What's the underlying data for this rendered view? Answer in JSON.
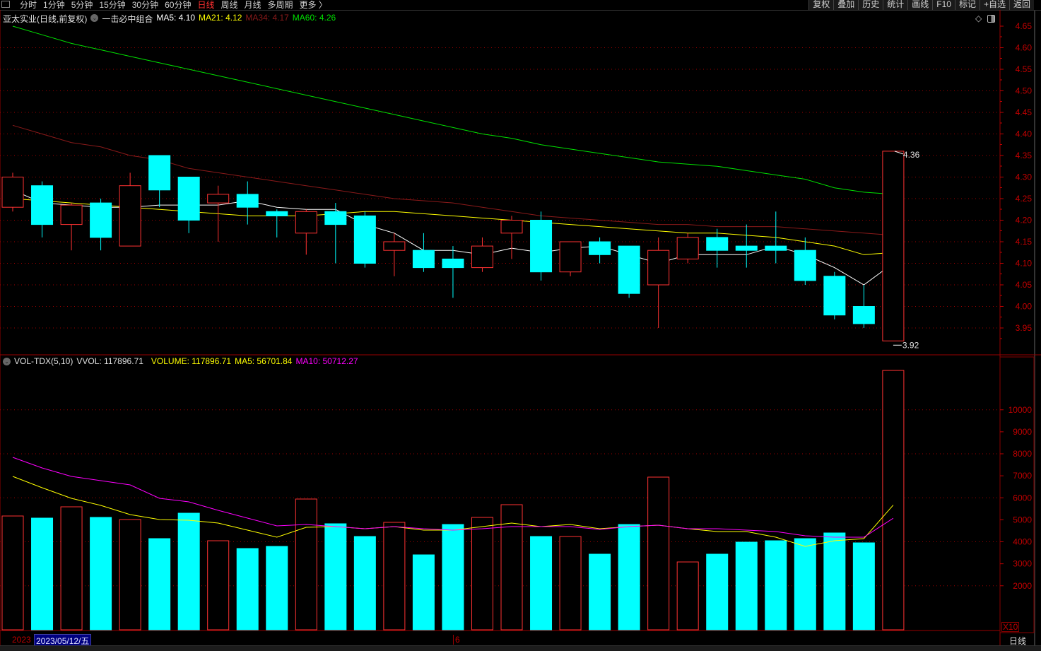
{
  "toolbar": {
    "periods": [
      "分时",
      "1分钟",
      "5分钟",
      "15分钟",
      "30分钟",
      "60分钟",
      "日线",
      "周线",
      "月线",
      "多周期",
      "更多 〉"
    ],
    "active_period": "日线",
    "buttons": [
      "复权",
      "叠加",
      "历史",
      "统计",
      "画线",
      "F10",
      "标记",
      "+自选",
      "返回"
    ]
  },
  "price_legend": {
    "title": "亚太实业(日线,前复权)",
    "indicator": "一击必中组合",
    "ma5": "MA5: 4.10",
    "ma21": "MA21: 4.12",
    "ma34": "MA34: 4.17",
    "ma60": "MA60: 4.26"
  },
  "volume_legend": {
    "name": "VOL-TDX(5,10)",
    "vvol": "VVOL: 117896.71",
    "volume": "VOLUME: 117896.71",
    "ma5": "MA5: 56701.84",
    "ma10": "MA10: 50712.27"
  },
  "colors": {
    "up": "#ff3232",
    "down": "#00ffff",
    "ma5": "#ffffff",
    "ma21": "#ffff00",
    "ma34": "#8b1a1a",
    "ma60": "#00e000",
    "vol_ma5": "#ffff00",
    "vol_ma10": "#ff00ff",
    "axis": "#c00000"
  },
  "icons": {
    "legend_toggle": "chevron-down-circle-icon",
    "diamond": "diamond-icon",
    "panel": "panel-toggle-icon"
  },
  "date_axis": {
    "left_label": "2023",
    "cursor_date": "2023/05/12/五",
    "month_label": "6"
  },
  "period_label": "日线",
  "volume_unit": "X10",
  "chart_data": [
    {
      "type": "candlestick",
      "price_axis": {
        "ticks": [
          4.65,
          4.6,
          4.55,
          4.5,
          4.45,
          4.4,
          4.35,
          4.3,
          4.25,
          4.2,
          4.15,
          4.1,
          4.05,
          4.0,
          3.95
        ],
        "range": [
          3.92,
          4.65
        ]
      },
      "high_label": "4.36",
      "low_label": "3.92",
      "ohlc": [
        [
          4.23,
          4.31,
          4.22,
          4.3
        ],
        [
          4.28,
          4.29,
          4.16,
          4.19
        ],
        [
          4.19,
          4.24,
          4.13,
          4.235
        ],
        [
          4.24,
          4.25,
          4.13,
          4.16
        ],
        [
          4.14,
          4.31,
          4.14,
          4.28
        ],
        [
          4.35,
          4.35,
          4.23,
          4.27
        ],
        [
          4.3,
          4.3,
          4.17,
          4.2
        ],
        [
          4.24,
          4.28,
          4.15,
          4.26
        ],
        [
          4.26,
          4.29,
          4.19,
          4.23
        ],
        [
          4.22,
          4.225,
          4.16,
          4.21
        ],
        [
          4.17,
          4.225,
          4.12,
          4.22
        ],
        [
          4.22,
          4.24,
          4.1,
          4.19
        ],
        [
          4.21,
          4.22,
          4.09,
          4.1
        ],
        [
          4.13,
          4.17,
          4.07,
          4.15
        ],
        [
          4.13,
          4.17,
          4.08,
          4.09
        ],
        [
          4.11,
          4.14,
          4.02,
          4.09
        ],
        [
          4.09,
          4.16,
          4.08,
          4.14
        ],
        [
          4.17,
          4.21,
          4.11,
          4.2
        ],
        [
          4.2,
          4.22,
          4.06,
          4.08
        ],
        [
          4.08,
          4.15,
          4.07,
          4.15
        ],
        [
          4.15,
          4.16,
          4.1,
          4.12
        ],
        [
          4.14,
          4.14,
          4.02,
          4.03
        ],
        [
          4.05,
          4.16,
          3.95,
          4.13
        ],
        [
          4.11,
          4.17,
          4.1,
          4.16
        ],
        [
          4.16,
          4.18,
          4.09,
          4.13
        ],
        [
          4.14,
          4.19,
          4.09,
          4.13
        ],
        [
          4.14,
          4.22,
          4.1,
          4.13
        ],
        [
          4.13,
          4.16,
          4.05,
          4.06
        ],
        [
          4.07,
          4.08,
          3.97,
          3.98
        ],
        [
          4.0,
          4.05,
          3.95,
          3.96
        ],
        [
          3.92,
          4.36,
          3.92,
          4.36
        ]
      ],
      "series": [
        {
          "name": "MA5",
          "values": [
            4.27,
            4.24,
            4.235,
            4.23,
            4.23,
            4.235,
            4.235,
            4.235,
            4.245,
            4.23,
            4.225,
            4.225,
            4.19,
            4.17,
            4.13,
            4.13,
            4.12,
            4.135,
            4.125,
            4.135,
            4.14,
            4.12,
            4.1,
            4.12,
            4.12,
            4.12,
            4.14,
            4.12,
            4.09,
            4.05,
            4.1
          ]
        },
        {
          "name": "MA21",
          "values": [
            4.25,
            4.245,
            4.24,
            4.235,
            4.23,
            4.225,
            4.22,
            4.215,
            4.21,
            4.21,
            4.21,
            4.215,
            4.22,
            4.22,
            4.215,
            4.21,
            4.205,
            4.2,
            4.195,
            4.19,
            4.185,
            4.18,
            4.175,
            4.17,
            4.17,
            4.165,
            4.16,
            4.15,
            4.14,
            4.12,
            4.125
          ]
        },
        {
          "name": "MA34",
          "values": [
            4.42,
            4.4,
            4.38,
            4.37,
            4.35,
            4.34,
            4.32,
            4.31,
            4.3,
            4.29,
            4.28,
            4.27,
            4.26,
            4.25,
            4.245,
            4.24,
            4.23,
            4.22,
            4.21,
            4.205,
            4.2,
            4.195,
            4.19,
            4.19,
            4.185,
            4.185,
            4.185,
            4.18,
            4.175,
            4.17,
            4.165
          ]
        },
        {
          "name": "MA60",
          "values": [
            4.65,
            4.63,
            4.61,
            4.595,
            4.58,
            4.565,
            4.55,
            4.535,
            4.52,
            4.505,
            4.49,
            4.475,
            4.46,
            4.445,
            4.43,
            4.415,
            4.4,
            4.39,
            4.375,
            4.365,
            4.355,
            4.345,
            4.335,
            4.33,
            4.325,
            4.315,
            4.305,
            4.295,
            4.275,
            4.265,
            4.26
          ]
        }
      ]
    },
    {
      "type": "bar",
      "yaxis_ticks": [
        10000,
        9000,
        8000,
        7000,
        6000,
        5000,
        4000,
        3000,
        2000
      ],
      "values": [
        5173,
        5077,
        5590,
        5109,
        5012,
        4145,
        5301,
        4048,
        3695,
        3791,
        5944,
        4820,
        4241,
        4884,
        3406,
        4787,
        5109,
        5687,
        4241,
        4241,
        3438,
        4787,
        6940,
        3084,
        3438,
        3984,
        4048,
        4145,
        4402,
        3952,
        11790
      ],
      "series": [
        {
          "name": "MA5",
          "values": [
            6972,
            6458,
            5976,
            5655,
            5237,
            5012,
            4980,
            4852,
            4530,
            4209,
            4659,
            4691,
            4595,
            4691,
            4530,
            4530,
            4691,
            4852,
            4691,
            4787,
            4595,
            4691,
            4755,
            4595,
            4466,
            4466,
            4209,
            3791,
            4048,
            4145,
            5670
          ]
        },
        {
          "name": "MA10",
          "values": [
            7840,
            7358,
            6972,
            6779,
            6587,
            5976,
            5816,
            5430,
            5077,
            4723,
            4787,
            4691,
            4595,
            4691,
            4595,
            4530,
            4595,
            4691,
            4691,
            4691,
            4562,
            4691,
            4755,
            4595,
            4595,
            4530,
            4466,
            4273,
            4209,
            4209,
            5071
          ]
        }
      ]
    }
  ]
}
